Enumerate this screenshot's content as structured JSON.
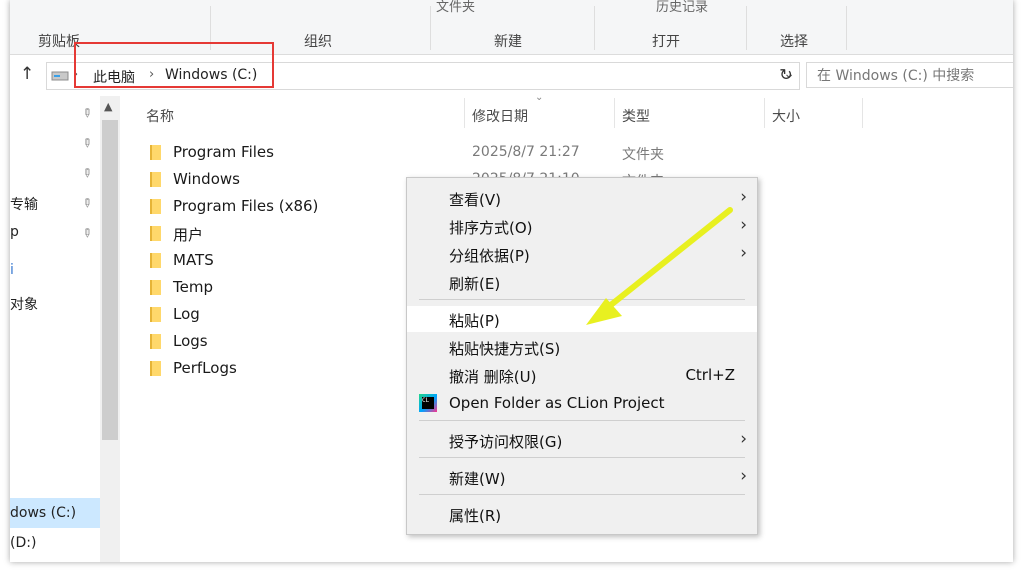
{
  "ribbon": {
    "cut_labels": [
      "文件夹",
      "历史记录"
    ],
    "groups": [
      "剪贴板",
      "组织",
      "新建",
      "打开",
      "选择"
    ]
  },
  "address": {
    "breadcrumbs": [
      "此电脑",
      "Windows (C:)"
    ],
    "search_placeholder": "在 Windows (C:) 中搜索"
  },
  "nav_pane": {
    "items": [
      "专输",
      "p",
      "i",
      "对象",
      "dows (C:)",
      "(D:)"
    ],
    "selected": "dows (C:)"
  },
  "columns": [
    "名称",
    "修改日期",
    "类型",
    "大小"
  ],
  "files": [
    {
      "name": "Program Files",
      "date": "2025/8/7 21:27",
      "type": "文件夹"
    },
    {
      "name": "Windows",
      "date": "2025/8/7 21:10",
      "type": "文件夹"
    },
    {
      "name": "Program Files (x86)",
      "date": "",
      "type": ""
    },
    {
      "name": "用户",
      "date": "",
      "type": ""
    },
    {
      "name": "MATS",
      "date": "",
      "type": ""
    },
    {
      "name": "Temp",
      "date": "",
      "type": ""
    },
    {
      "name": "Log",
      "date": "",
      "type": ""
    },
    {
      "name": "Logs",
      "date": "",
      "type": ""
    },
    {
      "name": "PerfLogs",
      "date": "",
      "type": ""
    }
  ],
  "context_menu": {
    "view": "查看(V)",
    "sort": "排序方式(O)",
    "group": "分组依据(P)",
    "refresh": "刷新(E)",
    "paste": "粘贴(P)",
    "paste_shortcut": "粘贴快捷方式(S)",
    "undo_delete": "撤消 删除(U)",
    "undo_shortcut": "Ctrl+Z",
    "clion": "Open Folder as CLion Project",
    "grant_access": "授予访问权限(G)",
    "new": "新建(W)",
    "properties": "属性(R)",
    "clion_icon_text": "CL"
  },
  "colors": {
    "highlight_box": "#e53935",
    "annotation_arrow": "#e8f020",
    "selection": "#cce8ff"
  },
  "icons": [
    "up-arrow-icon",
    "drive-icon",
    "chevron-right-icon",
    "chevron-down-icon",
    "refresh-icon",
    "pin-icon",
    "folder-icon",
    "clion-icon"
  ]
}
